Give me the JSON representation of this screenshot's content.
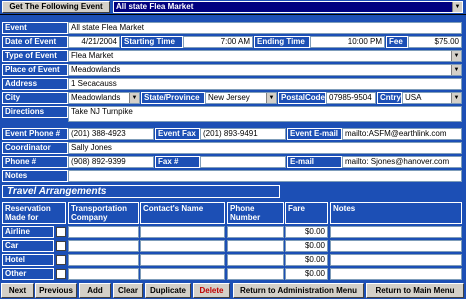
{
  "top": {
    "get_label": "Get The Following Event",
    "event_select": "All state Flea Market"
  },
  "labels": {
    "event": "Event",
    "date": "Date of Event",
    "start": "Starting Time",
    "end": "Ending Time",
    "fee": "Fee",
    "type": "Type of Event",
    "place": "Place of Event",
    "address": "Address",
    "city": "City",
    "state": "State/Province",
    "postal": "PostalCode",
    "country": "Cntry",
    "directions": "Directions",
    "event_phone": "Event Phone #",
    "event_fax": "Event Fax",
    "event_email": "Event E-mail",
    "coordinator": "Coordinator",
    "phone": "Phone #",
    "fax": "Fax #",
    "email": "E-mail",
    "notes": "Notes"
  },
  "values": {
    "event": "All state Flea Market",
    "date": "4/21/2004",
    "start": "7:00 AM",
    "end": "10:00 PM",
    "fee": "$75.00",
    "type": "Flea Market",
    "place": "Meadowlands",
    "address": "1 Secacauss",
    "city": "Meadowlands",
    "state": "New Jersey",
    "postal": "07985-9504",
    "country": "USA",
    "directions": "Take NJ Turnpike",
    "event_phone": "(201) 388-4923",
    "event_fax": "(201) 893-9491",
    "event_email": "mailto:ASFM@earthlink.com",
    "coordinator": "Sally Jones",
    "phone": "(908) 892-9399",
    "fax": "",
    "email": "mailto: Sjones@hanover.com",
    "notes": ""
  },
  "travel": {
    "title": "Travel Arrangements",
    "headers": {
      "reservation": "Reservation Made for",
      "company": "Transportation Company",
      "contact": "Contact's Name",
      "phone": "Phone Number",
      "fare": "Fare",
      "notes": "Notes"
    },
    "rows": [
      {
        "label": "Airline",
        "fare": "$0.00"
      },
      {
        "label": "Car",
        "fare": "$0.00"
      },
      {
        "label": "Hotel",
        "fare": "$0.00"
      },
      {
        "label": "Other",
        "fare": "$0.00"
      }
    ]
  },
  "buttons": {
    "next": "Next",
    "previous": "Previous",
    "add": "Add",
    "clear": "Clear",
    "duplicate": "Duplicate",
    "delete": "Delete",
    "return_admin": "Return to Administration Menu",
    "return_main": "Return to Main Menu"
  }
}
